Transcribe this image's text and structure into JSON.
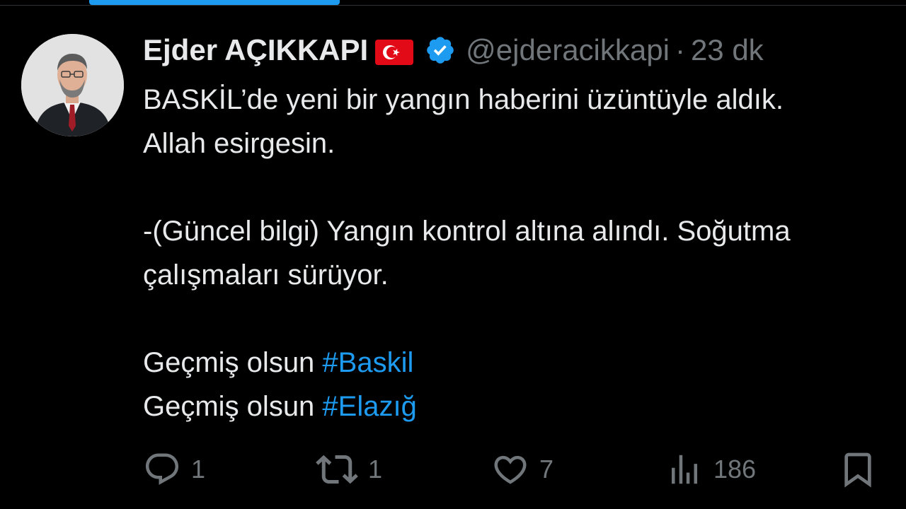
{
  "tweet": {
    "display_name": "Ejder AÇIKKAPI",
    "handle": "@ejderacikkapi",
    "separator": "·",
    "time": "23 dk",
    "lines": {
      "l1": "BASKİL’de yeni bir yangın haberini üzüntüyle aldık.",
      "l2": "Allah esirgesin.",
      "l3": "-(Güncel bilgi) Yangın kontrol altına alındı. Soğutma",
      "l4": "çalışmaları sürüyor.",
      "l5_text": "Geçmiş olsun ",
      "l5_tag": "#Baskil",
      "l6_text": "Geçmiş olsun ",
      "l6_tag": "#Elazığ"
    },
    "actions": {
      "reply_count": "1",
      "retweet_count": "1",
      "like_count": "7",
      "views_count": "186"
    },
    "icons": {
      "flag": "turkey-flag-icon",
      "verified": "verified-badge-icon",
      "reply": "reply-icon",
      "retweet": "retweet-icon",
      "like": "heart-icon",
      "views": "views-icon",
      "bookmark": "bookmark-icon"
    },
    "colors": {
      "background": "#000000",
      "text": "#e7e9ea",
      "muted": "#71767b",
      "accent": "#1d9bf0",
      "flag_red": "#e30a17"
    }
  }
}
